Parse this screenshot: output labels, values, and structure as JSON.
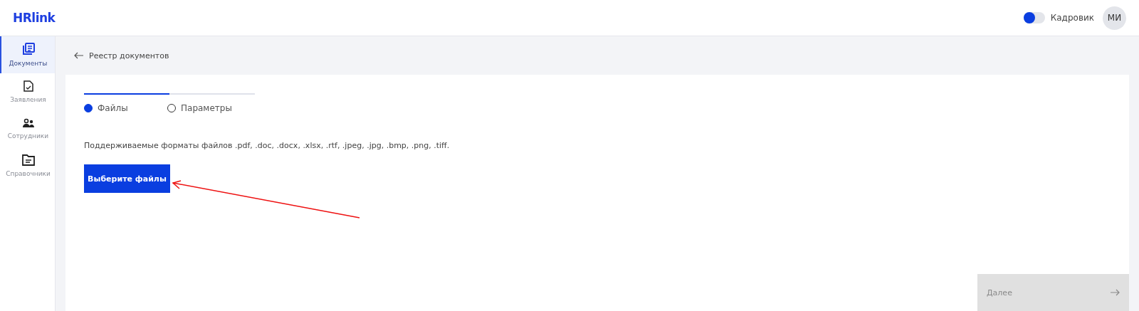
{
  "header": {
    "logo": "HRlink",
    "role_toggle": {
      "label": "Кадровик",
      "on": false
    },
    "avatar": "МИ"
  },
  "sidebar": {
    "items": [
      {
        "label": "Документы",
        "kind": "documents",
        "selected": true
      },
      {
        "label": "Заявления",
        "kind": "application",
        "selected": false
      },
      {
        "label": "Сотрудники",
        "kind": "people",
        "selected": false
      },
      {
        "label": "Справочники",
        "kind": "folder",
        "selected": false
      }
    ]
  },
  "breadcrumb": "Реестр документов",
  "stepper": {
    "level": 0.5,
    "steps": [
      {
        "label": "Файлы",
        "selected": true
      },
      {
        "label": "Параметры",
        "selected": false
      }
    ]
  },
  "formats_text": "Поддерживаемые форматы файлов .pdf, .doc, .docx, .xlsx, .rtf, .jpeg, .jpg, .bmp, .png, .tiff.",
  "choose_button": "Выберите файлы",
  "next_button": {
    "label": "Далее",
    "disabled": true
  }
}
